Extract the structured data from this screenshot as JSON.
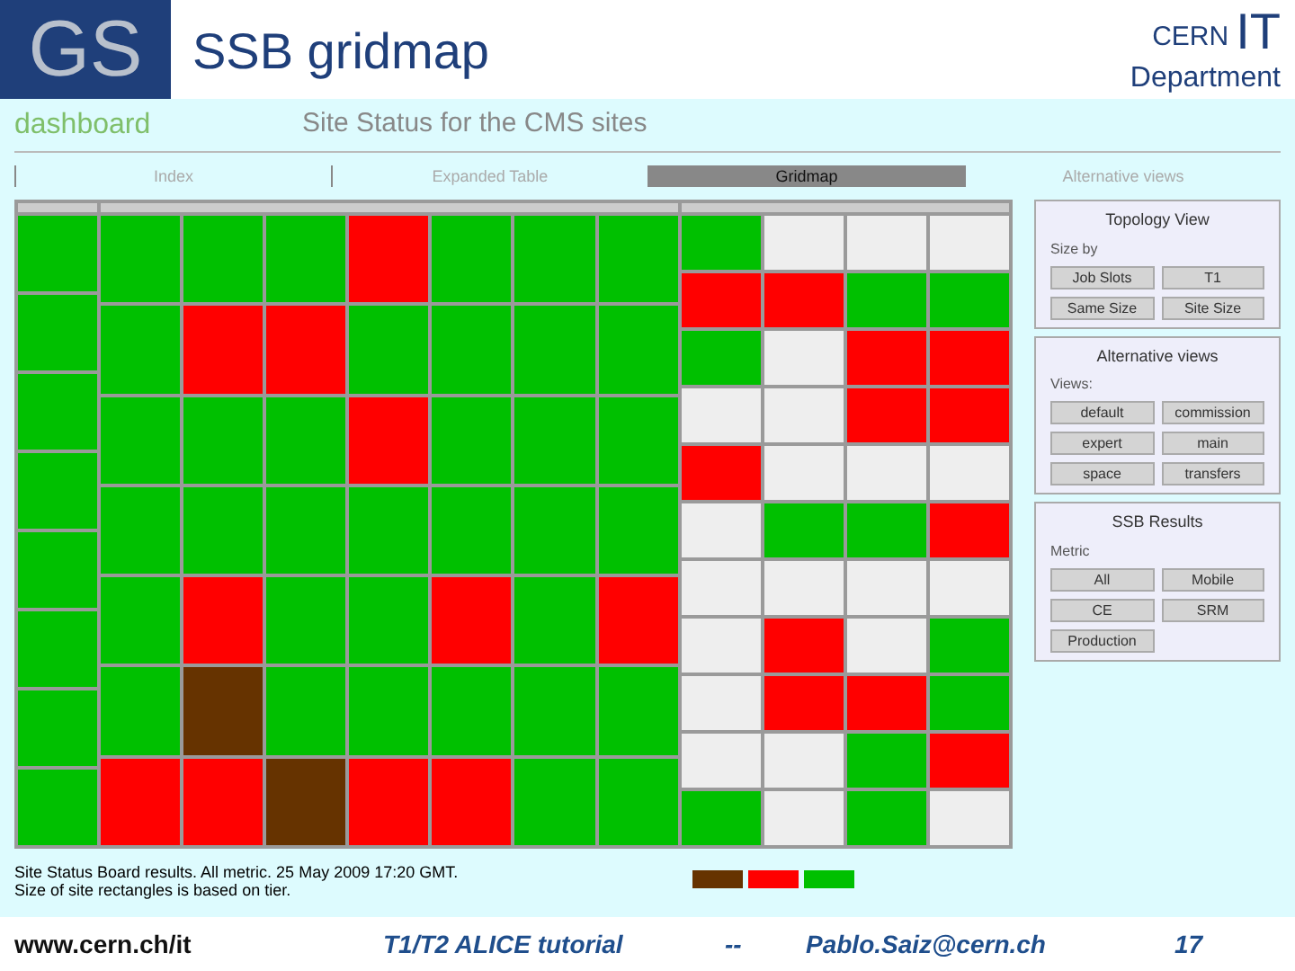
{
  "slide": {
    "logo": "GS",
    "title": "SSB gridmap",
    "org": "CERN",
    "org_unit": "IT",
    "department": "Department"
  },
  "page": {
    "brand": "dashboard",
    "title": "Site Status for the CMS sites"
  },
  "tabs": [
    {
      "label": "Index",
      "selected": false
    },
    {
      "label": "Expanded Table",
      "selected": false
    },
    {
      "label": "Gridmap",
      "selected": true
    },
    {
      "label": "Alternative views",
      "selected": false
    }
  ],
  "treemap": {
    "groups": [
      {
        "columns": [
          [
            {
              "color": "#00c000"
            },
            {
              "color": "#00c000"
            },
            {
              "color": "#00c000"
            },
            {
              "color": "#00c000"
            },
            {
              "color": "#00c000"
            },
            {
              "color": "#00c000"
            },
            {
              "color": "#00c000"
            },
            {
              "color": "#00c000"
            }
          ]
        ]
      },
      {
        "columns": [
          [
            {
              "color": "#00c000"
            },
            {
              "color": "#00c000"
            },
            {
              "color": "#00c000"
            },
            {
              "color": "#00c000"
            },
            {
              "color": "#00c000"
            },
            {
              "color": "#00c000"
            },
            {
              "color": "#ff0000"
            }
          ],
          [
            {
              "color": "#00c000"
            },
            {
              "color": "#ff0000"
            },
            {
              "color": "#00c000"
            },
            {
              "color": "#00c000"
            },
            {
              "color": "#ff0000"
            },
            {
              "color": "#663300"
            },
            {
              "color": "#ff0000"
            }
          ],
          [
            {
              "color": "#00c000"
            },
            {
              "color": "#ff0000"
            },
            {
              "color": "#00c000"
            },
            {
              "color": "#00c000"
            },
            {
              "color": "#00c000"
            },
            {
              "color": "#00c000"
            },
            {
              "color": "#663300"
            }
          ],
          [
            {
              "color": "#ff0000"
            },
            {
              "color": "#00c000"
            },
            {
              "color": "#ff0000"
            },
            {
              "color": "#00c000"
            },
            {
              "color": "#00c000"
            },
            {
              "color": "#00c000"
            },
            {
              "color": "#ff0000"
            }
          ],
          [
            {
              "color": "#00c000"
            },
            {
              "color": "#00c000"
            },
            {
              "color": "#00c000"
            },
            {
              "color": "#00c000"
            },
            {
              "color": "#ff0000"
            },
            {
              "color": "#00c000"
            },
            {
              "color": "#ff0000"
            }
          ],
          [
            {
              "color": "#00c000"
            },
            {
              "color": "#00c000"
            },
            {
              "color": "#00c000"
            },
            {
              "color": "#00c000"
            },
            {
              "color": "#00c000"
            },
            {
              "color": "#00c000"
            },
            {
              "color": "#00c000"
            }
          ],
          [
            {
              "color": "#00c000"
            },
            {
              "color": "#00c000"
            },
            {
              "color": "#00c000"
            },
            {
              "color": "#00c000"
            },
            {
              "color": "#ff0000"
            },
            {
              "color": "#00c000"
            },
            {
              "color": "#00c000"
            }
          ]
        ]
      },
      {
        "columns": [
          [
            {
              "color": "#00c000"
            },
            {
              "color": "#ff0000"
            },
            {
              "color": "#00c000"
            },
            {
              "color": "#eeeeee"
            },
            {
              "color": "#ff0000"
            },
            {
              "color": "#eeeeee"
            },
            {
              "color": "#eeeeee"
            },
            {
              "color": "#eeeeee"
            },
            {
              "color": "#eeeeee"
            },
            {
              "color": "#eeeeee"
            },
            {
              "color": "#00c000"
            }
          ],
          [
            {
              "color": "#eeeeee"
            },
            {
              "color": "#ff0000"
            },
            {
              "color": "#eeeeee"
            },
            {
              "color": "#eeeeee"
            },
            {
              "color": "#eeeeee"
            },
            {
              "color": "#00c000"
            },
            {
              "color": "#eeeeee"
            },
            {
              "color": "#ff0000"
            },
            {
              "color": "#ff0000"
            },
            {
              "color": "#eeeeee"
            },
            {
              "color": "#eeeeee"
            }
          ],
          [
            {
              "color": "#eeeeee"
            },
            {
              "color": "#00c000"
            },
            {
              "color": "#ff0000"
            },
            {
              "color": "#ff0000"
            },
            {
              "color": "#eeeeee"
            },
            {
              "color": "#00c000"
            },
            {
              "color": "#eeeeee"
            },
            {
              "color": "#eeeeee"
            },
            {
              "color": "#ff0000"
            },
            {
              "color": "#00c000"
            },
            {
              "color": "#00c000"
            }
          ],
          [
            {
              "color": "#eeeeee"
            },
            {
              "color": "#00c000"
            },
            {
              "color": "#ff0000"
            },
            {
              "color": "#ff0000"
            },
            {
              "color": "#eeeeee"
            },
            {
              "color": "#ff0000"
            },
            {
              "color": "#eeeeee"
            },
            {
              "color": "#00c000"
            },
            {
              "color": "#00c000"
            },
            {
              "color": "#ff0000"
            },
            {
              "color": "#eeeeee"
            }
          ]
        ]
      }
    ]
  },
  "panels": [
    {
      "title": "Topology View",
      "label": "Size by",
      "buttons": [
        "Job Slots",
        "T1",
        "Same Size",
        "Site Size"
      ]
    },
    {
      "title": "Alternative views",
      "label": "Views:",
      "buttons": [
        "default",
        "commission",
        "expert",
        "main",
        "space",
        "transfers"
      ]
    },
    {
      "title": "SSB Results",
      "label": "Metric",
      "buttons": [
        "All",
        "Mobile",
        "CE",
        "SRM",
        "Production"
      ]
    }
  ],
  "caption": [
    "Site Status Board results. All metric. 25 May 2009 17:20 GMT.",
    "Size of site rectangles is based on tier."
  ],
  "legend": [
    {
      "color": "#663300"
    },
    {
      "color": "#ff0000"
    },
    {
      "color": "#00c000"
    }
  ],
  "footer": {
    "url": "www.cern.ch/it",
    "course": "T1/T2 ALICE tutorial",
    "separator": "--",
    "email": "Pablo.Saiz@cern.ch",
    "page": "17"
  }
}
